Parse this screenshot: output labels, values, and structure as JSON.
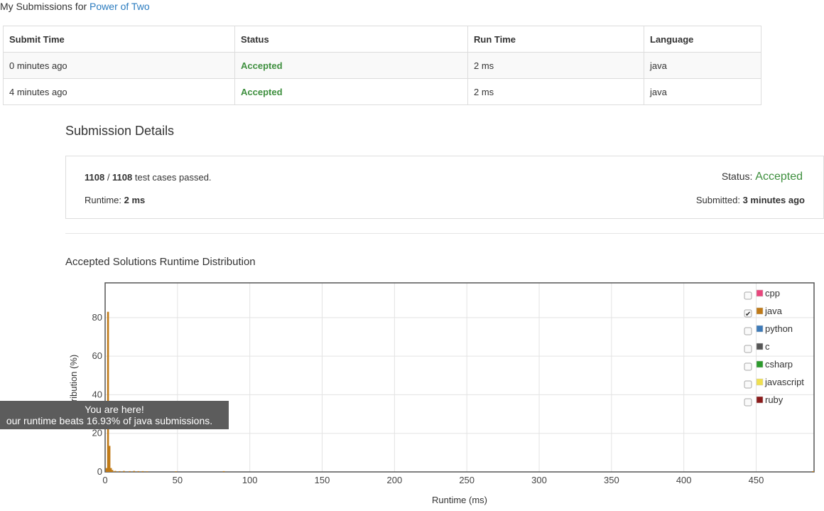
{
  "header": {
    "prefix": "My Submissions for",
    "problem_link": "Power of Two"
  },
  "submissions_table": {
    "columns": [
      "Submit Time",
      "Status",
      "Run Time",
      "Language"
    ],
    "rows": [
      {
        "submit_time": "0 minutes ago",
        "status": "Accepted",
        "run_time": "2 ms",
        "language": "java"
      },
      {
        "submit_time": "4 minutes ago",
        "status": "Accepted",
        "run_time": "2 ms",
        "language": "java"
      }
    ]
  },
  "details": {
    "title": "Submission Details",
    "passed": "1108",
    "separator": " / ",
    "total": "1108",
    "passed_suffix": " test cases passed.",
    "runtime_label": "Runtime: ",
    "runtime_value": "2 ms",
    "status_label": "Status: ",
    "status_value": "Accepted",
    "submitted_label": "Submitted: ",
    "submitted_value": "3 minutes ago"
  },
  "distribution": {
    "title": "Accepted Solutions Runtime Distribution"
  },
  "tooltip": {
    "line1": "You are here!",
    "line2": "our runtime beats 16.93% of java submissions."
  },
  "chart_data": {
    "type": "bar",
    "xlabel": "Runtime (ms)",
    "ylabel": "ribution (%)",
    "xlim": [
      0,
      490
    ],
    "ylim": [
      0,
      98
    ],
    "x_ticks": [
      0,
      50,
      100,
      150,
      200,
      250,
      300,
      350,
      400,
      450
    ],
    "y_ticks": [
      0,
      20,
      40,
      60,
      80
    ],
    "grid": true,
    "legend_position": "top-right",
    "legend": [
      {
        "name": "cpp",
        "color": "#e8467c",
        "checked": false
      },
      {
        "name": "java",
        "color": "#c07a17",
        "checked": true
      },
      {
        "name": "python",
        "color": "#3d7ab8",
        "checked": false
      },
      {
        "name": "c",
        "color": "#555555",
        "checked": false
      },
      {
        "name": "csharp",
        "color": "#2b9a2b",
        "checked": false
      },
      {
        "name": "javascript",
        "color": "#f0e050",
        "checked": false
      },
      {
        "name": "ruby",
        "color": "#8b1a1a",
        "checked": false
      }
    ],
    "series": [
      {
        "name": "java",
        "color": "#c07a17",
        "x": [
          1,
          2,
          3,
          4,
          5,
          7,
          10,
          13,
          17,
          20,
          23,
          26,
          29,
          49,
          82,
          490
        ],
        "values": [
          2,
          83,
          13.5,
          2,
          1,
          0.5,
          0.4,
          0.5,
          0.4,
          0.5,
          0.4,
          0.4,
          0.3,
          0.3,
          0.4,
          0.4
        ]
      }
    ]
  }
}
